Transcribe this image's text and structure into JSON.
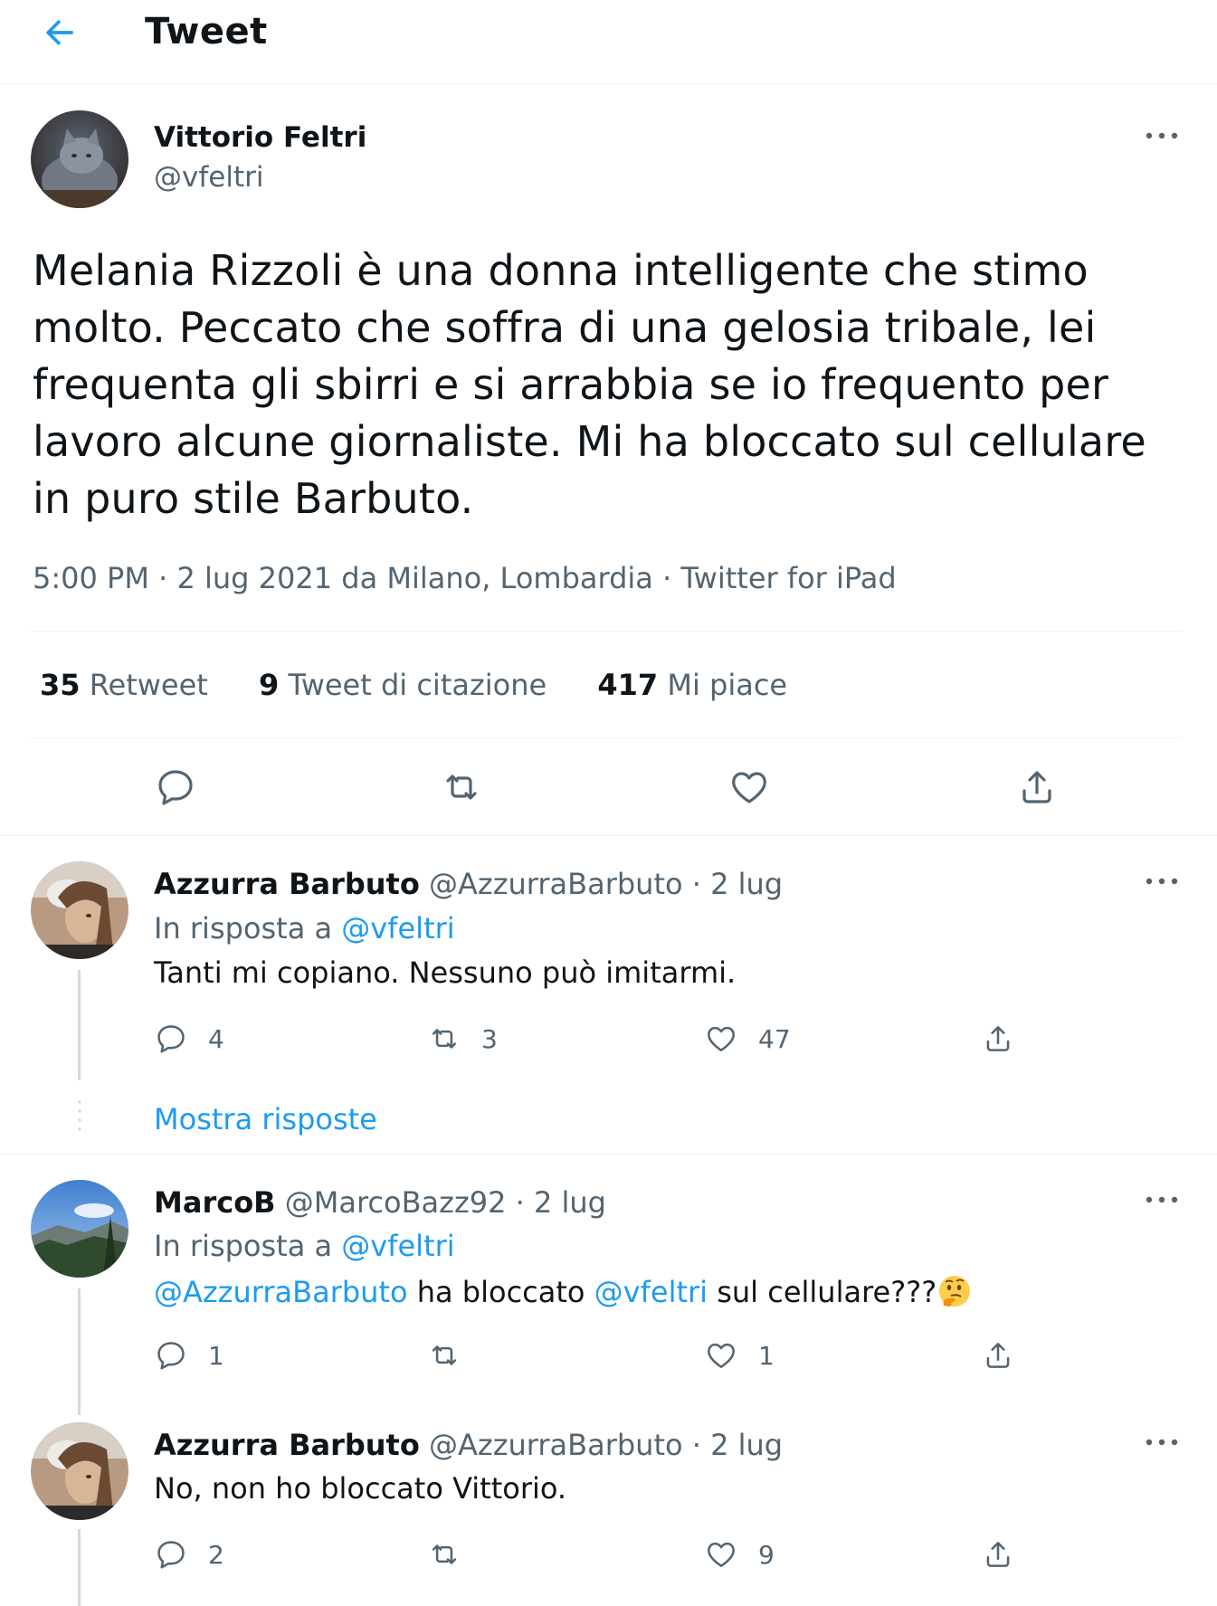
{
  "header": {
    "title": "Tweet"
  },
  "main_tweet": {
    "name": "Vittorio Feltri",
    "handle": "@vfeltri",
    "text": "Melania Rizzoli è una donna intelligente che stimo molto. Peccato che soffra di una gelosia tribale, lei frequenta gli sbirri e si arrabbia se io frequento per lavoro alcune giornaliste. Mi ha bloccato sul cellulare in puro stile Barbuto.",
    "meta": "5:00 PM · 2 lug 2021 da Milano, Lombardia · Twitter for iPad",
    "stats": {
      "retweets": "35",
      "retweets_label": "Retweet",
      "quotes": "9",
      "quotes_label": "Tweet di citazione",
      "likes": "417",
      "likes_label": "Mi piace"
    }
  },
  "replies": [
    {
      "name": "Azzurra Barbuto",
      "handle": "@AzzurraBarbuto · 2 lug",
      "reply_prefix": "In risposta a",
      "reply_to": "@vfeltri",
      "text": "Tanti mi copiano. Nessuno può imitarmi.",
      "replies": "4",
      "retweets": "3",
      "likes": "47"
    },
    {
      "name": "MarcoB",
      "handle": "@MarcoBazz92 · 2 lug",
      "reply_prefix": "In risposta a",
      "reply_to": "@vfeltri",
      "text_mention1": "@AzzurraBarbuto",
      "text_mid": " ha bloccato ",
      "text_mention2": "@vfeltri",
      "text_end": " sul cellulare???",
      "emoji": "thinking-face",
      "replies": "1",
      "retweets": "",
      "likes": "1"
    },
    {
      "name": "Azzurra Barbuto",
      "handle": "@AzzurraBarbuto · 2 lug",
      "text": "No, non ho bloccato Vittorio.",
      "replies": "2",
      "retweets": "",
      "likes": "9"
    }
  ],
  "show_replies": "Mostra risposte",
  "colors": {
    "accent": "#1d9bf0",
    "secondary_text": "#536471",
    "text": "#0f1419"
  }
}
